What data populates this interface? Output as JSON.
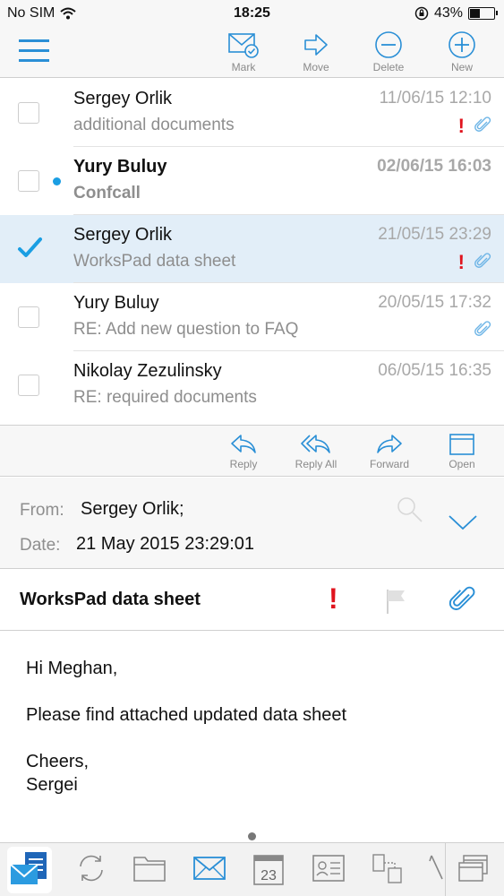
{
  "status_bar": {
    "carrier": "No SIM",
    "time": "18:25",
    "battery": "43%",
    "battery_level": 0.43
  },
  "toolbar": {
    "mark": "Mark",
    "move": "Move",
    "delete": "Delete",
    "new": "New"
  },
  "messages": [
    {
      "sender": "Sergey Orlik",
      "subject": "additional documents",
      "date": "11/06/15 12:10"
    },
    {
      "sender": "Yury Buluy",
      "subject": "Confcall",
      "date": "02/06/15 16:03"
    },
    {
      "sender": "Sergey Orlik",
      "subject": "WorksPad data sheet",
      "date": "21/05/15 23:29"
    },
    {
      "sender": "Yury Buluy",
      "subject": "RE: Add new question to FAQ",
      "date": "20/05/15 17:32"
    },
    {
      "sender": "Nikolay Zezulinsky",
      "subject": "RE: required documents",
      "date": "06/05/15 16:35"
    }
  ],
  "important_mark": "!",
  "actions": {
    "reply": "Reply",
    "reply_all": "Reply All",
    "forward": "Forward",
    "open": "Open"
  },
  "header": {
    "from_label": "From:",
    "from_value": "Sergey Orlik;",
    "date_label": "Date:",
    "date_value": "21 May 2015 23:29:01"
  },
  "subject_bar": {
    "title": "WorksPad data sheet"
  },
  "body": {
    "greeting": "Hi Meghan,",
    "text": "Please find attached updated data sheet",
    "closing": "Cheers,",
    "signature": "Sergei"
  },
  "dock": {
    "calendar_day": "23"
  },
  "colors": {
    "accent": "#2a8fd6",
    "important": "#e0141e",
    "selected_row": "#e2eef8",
    "unread": "#1a9ee3"
  }
}
